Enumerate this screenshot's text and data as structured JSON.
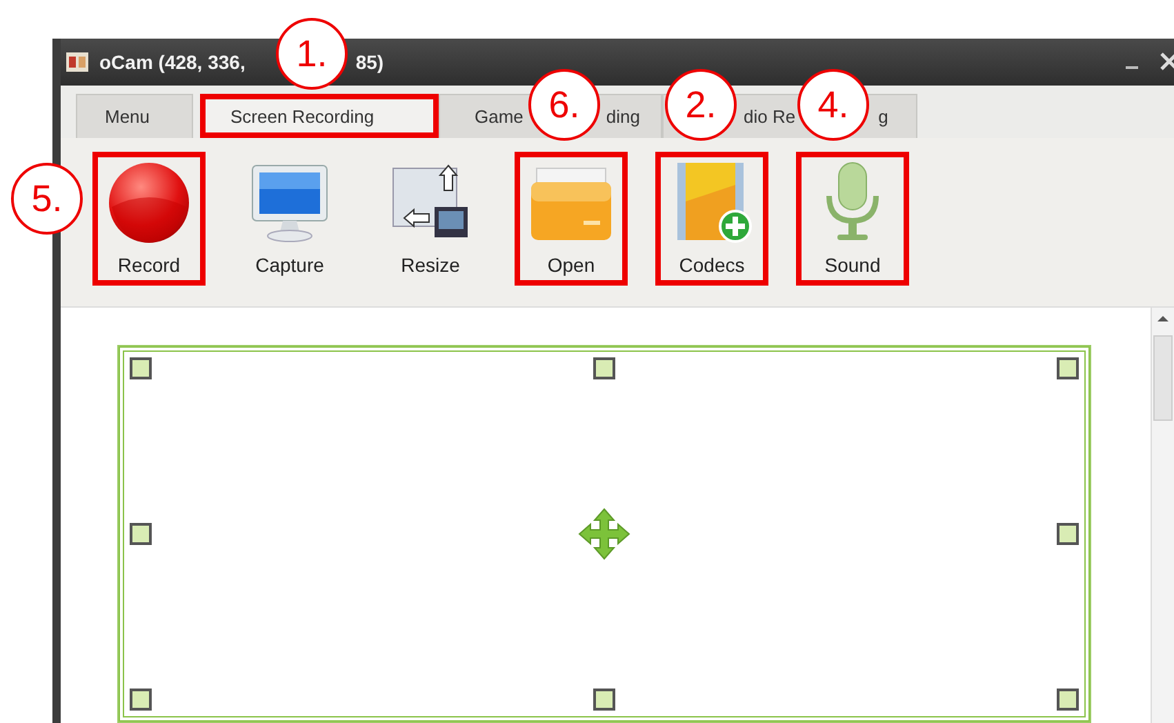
{
  "window": {
    "title_parts": [
      "oCam (428, 336,",
      "85)"
    ]
  },
  "tabs": [
    {
      "parts": [
        "Menu"
      ],
      "selected": false,
      "highlighted": false
    },
    {
      "parts": [
        "Screen Recording"
      ],
      "selected": true,
      "highlighted": true
    },
    {
      "parts": [
        "Game",
        "ding"
      ],
      "selected": false,
      "highlighted": false
    },
    {
      "parts": [
        "dio Re",
        "g"
      ],
      "selected": false,
      "highlighted": false,
      "covered_start": true
    }
  ],
  "toolbar": [
    {
      "kind": "record",
      "label": "Record",
      "highlighted": true
    },
    {
      "kind": "capture",
      "label": "Capture",
      "highlighted": false
    },
    {
      "kind": "resize",
      "label": "Resize",
      "highlighted": false
    },
    {
      "kind": "open",
      "label": "Open",
      "highlighted": true
    },
    {
      "kind": "codecs",
      "label": "Codecs",
      "highlighted": true
    },
    {
      "kind": "sound",
      "label": "Sound",
      "highlighted": true
    }
  ],
  "callouts": [
    {
      "number": "1."
    },
    {
      "number": "6."
    },
    {
      "number": "2."
    },
    {
      "number": "4."
    },
    {
      "number": "5."
    }
  ]
}
